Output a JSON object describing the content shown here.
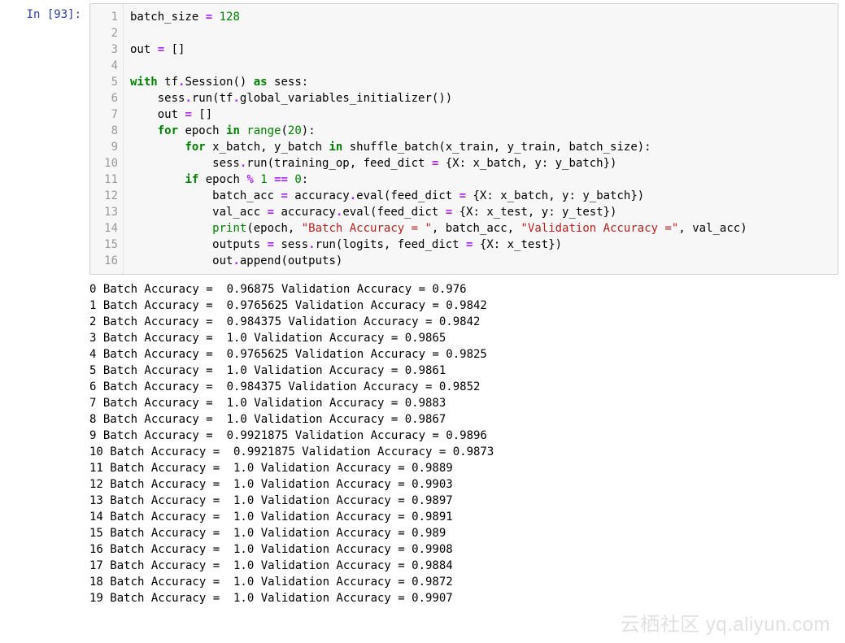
{
  "cell": {
    "prompt": "In [93]:",
    "exec_count": 93,
    "line_numbers": [
      "1",
      "2",
      "3",
      "4",
      "5",
      "6",
      "7",
      "8",
      "9",
      "10",
      "11",
      "12",
      "13",
      "14",
      "15",
      "16"
    ],
    "code_tokens": [
      [
        [
          "n",
          "batch_size"
        ],
        [
          "p",
          " "
        ],
        [
          "o",
          "="
        ],
        [
          "p",
          " "
        ],
        [
          "num",
          "128"
        ]
      ],
      [],
      [
        [
          "n",
          "out"
        ],
        [
          "p",
          " "
        ],
        [
          "o",
          "="
        ],
        [
          "p",
          " []"
        ]
      ],
      [],
      [
        [
          "k",
          "with"
        ],
        [
          "p",
          " tf"
        ],
        [
          "o",
          "."
        ],
        [
          "p",
          "Session() "
        ],
        [
          "k",
          "as"
        ],
        [
          "p",
          " sess:"
        ]
      ],
      [
        [
          "p",
          "    sess"
        ],
        [
          "o",
          "."
        ],
        [
          "p",
          "run(tf"
        ],
        [
          "o",
          "."
        ],
        [
          "p",
          "global_variables_initializer())"
        ]
      ],
      [
        [
          "p",
          "    out "
        ],
        [
          "o",
          "="
        ],
        [
          "p",
          " []"
        ]
      ],
      [
        [
          "p",
          "    "
        ],
        [
          "k",
          "for"
        ],
        [
          "p",
          " epoch "
        ],
        [
          "k",
          "in"
        ],
        [
          "p",
          " "
        ],
        [
          "nb",
          "range"
        ],
        [
          "p",
          "("
        ],
        [
          "num",
          "20"
        ],
        [
          "p",
          "):"
        ]
      ],
      [
        [
          "p",
          "        "
        ],
        [
          "k",
          "for"
        ],
        [
          "p",
          " x_batch, y_batch "
        ],
        [
          "k",
          "in"
        ],
        [
          "p",
          " shuffle_batch(x_train, y_train, batch_size):"
        ]
      ],
      [
        [
          "p",
          "            sess"
        ],
        [
          "o",
          "."
        ],
        [
          "p",
          "run(training_op, feed_dict "
        ],
        [
          "o",
          "="
        ],
        [
          "p",
          " {X: x_batch, y: y_batch})"
        ]
      ],
      [
        [
          "p",
          "        "
        ],
        [
          "k",
          "if"
        ],
        [
          "p",
          " epoch "
        ],
        [
          "o",
          "%"
        ],
        [
          "p",
          " "
        ],
        [
          "num",
          "1"
        ],
        [
          "p",
          " "
        ],
        [
          "o",
          "=="
        ],
        [
          "p",
          " "
        ],
        [
          "num",
          "0"
        ],
        [
          "p",
          ":"
        ]
      ],
      [
        [
          "p",
          "            batch_acc "
        ],
        [
          "o",
          "="
        ],
        [
          "p",
          " accuracy"
        ],
        [
          "o",
          "."
        ],
        [
          "p",
          "eval(feed_dict "
        ],
        [
          "o",
          "="
        ],
        [
          "p",
          " {X: x_batch, y: y_batch})"
        ]
      ],
      [
        [
          "p",
          "            val_acc "
        ],
        [
          "o",
          "="
        ],
        [
          "p",
          " accuracy"
        ],
        [
          "o",
          "."
        ],
        [
          "p",
          "eval(feed_dict "
        ],
        [
          "o",
          "="
        ],
        [
          "p",
          " {X: x_test, y: y_test})"
        ]
      ],
      [
        [
          "p",
          "            "
        ],
        [
          "nb",
          "print"
        ],
        [
          "p",
          "(epoch, "
        ],
        [
          "s",
          "\"Batch Accuracy = \""
        ],
        [
          "p",
          ", batch_acc, "
        ],
        [
          "s",
          "\"Validation Accuracy =\""
        ],
        [
          "p",
          ", val_acc)"
        ]
      ],
      [
        [
          "p",
          "            outputs "
        ],
        [
          "o",
          "="
        ],
        [
          "p",
          " sess"
        ],
        [
          "o",
          "."
        ],
        [
          "p",
          "run(logits, feed_dict "
        ],
        [
          "o",
          "="
        ],
        [
          "p",
          " {X: x_test})"
        ]
      ],
      [
        [
          "p",
          "            out"
        ],
        [
          "o",
          "."
        ],
        [
          "p",
          "append(outputs)"
        ]
      ]
    ]
  },
  "output_lines": [
    "0 Batch Accuracy =  0.96875 Validation Accuracy = 0.976",
    "1 Batch Accuracy =  0.9765625 Validation Accuracy = 0.9842",
    "2 Batch Accuracy =  0.984375 Validation Accuracy = 0.9842",
    "3 Batch Accuracy =  1.0 Validation Accuracy = 0.9865",
    "4 Batch Accuracy =  0.9765625 Validation Accuracy = 0.9825",
    "5 Batch Accuracy =  1.0 Validation Accuracy = 0.9861",
    "6 Batch Accuracy =  0.984375 Validation Accuracy = 0.9852",
    "7 Batch Accuracy =  1.0 Validation Accuracy = 0.9883",
    "8 Batch Accuracy =  1.0 Validation Accuracy = 0.9867",
    "9 Batch Accuracy =  0.9921875 Validation Accuracy = 0.9896",
    "10 Batch Accuracy =  0.9921875 Validation Accuracy = 0.9873",
    "11 Batch Accuracy =  1.0 Validation Accuracy = 0.9889",
    "12 Batch Accuracy =  1.0 Validation Accuracy = 0.9903",
    "13 Batch Accuracy =  1.0 Validation Accuracy = 0.9897",
    "14 Batch Accuracy =  1.0 Validation Accuracy = 0.9891",
    "15 Batch Accuracy =  1.0 Validation Accuracy = 0.989",
    "16 Batch Accuracy =  1.0 Validation Accuracy = 0.9908",
    "17 Batch Accuracy =  1.0 Validation Accuracy = 0.9884",
    "18 Batch Accuracy =  1.0 Validation Accuracy = 0.9872",
    "19 Batch Accuracy =  1.0 Validation Accuracy = 0.9907"
  ],
  "watermark": "云栖社区 yq.aliyun.com"
}
